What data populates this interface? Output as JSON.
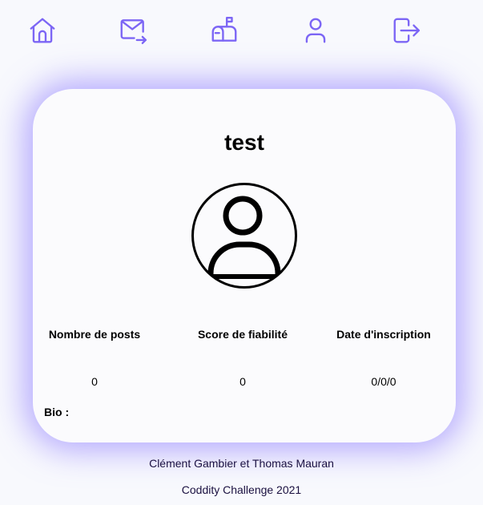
{
  "theme": {
    "accent": "#7c66f5",
    "glow": "#7c66ff",
    "background": "#f8f9fd",
    "footer_text": "#1a1040"
  },
  "navbar": {
    "items": [
      {
        "name": "home",
        "icon": "home-icon"
      },
      {
        "name": "messages",
        "icon": "mail-forward-icon"
      },
      {
        "name": "mailbox",
        "icon": "mailbox-icon"
      },
      {
        "name": "profile",
        "icon": "user-icon"
      },
      {
        "name": "logout",
        "icon": "logout-icon"
      }
    ]
  },
  "profile": {
    "username": "test",
    "avatar_icon": "user-circle-icon",
    "stats": [
      {
        "label": "Nombre de posts",
        "value": "0"
      },
      {
        "label": "Score de fiabilité",
        "value": "0"
      },
      {
        "label": "Date d'inscription",
        "value": "0/0/0"
      }
    ],
    "bio_label": "Bio :",
    "bio_text": ""
  },
  "footer": {
    "authors": "Clément Gambier et Thomas Mauran",
    "event": "Coddity Challenge 2021"
  }
}
